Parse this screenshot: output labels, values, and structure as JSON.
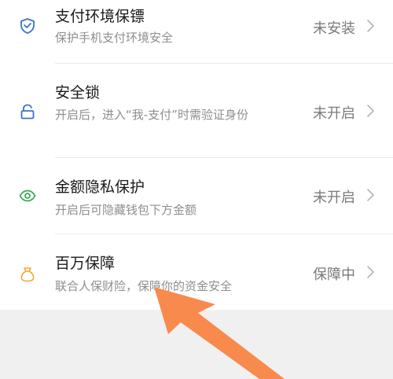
{
  "settings": {
    "items": [
      {
        "title": "支付环境保镖",
        "desc": "保护手机支付环境安全",
        "status": "未安装",
        "icon": "shield-check-icon",
        "color": "#3a72c9"
      },
      {
        "title": "安全锁",
        "desc": "开启后，进入“我-支付”时需验证身份",
        "status": "未开启",
        "icon": "lock-icon",
        "color": "#3a72c9"
      },
      {
        "title": "金额隐私保护",
        "desc": "开启后可隐藏钱包下方金额",
        "status": "未开启",
        "icon": "eye-icon",
        "color": "#3ca85a"
      },
      {
        "title": "百万保障",
        "desc": "联合人保财险，保障你的资金安全",
        "status": "保障中",
        "icon": "money-bag-icon",
        "color": "#f0a83a"
      }
    ]
  },
  "colors": {
    "annotation_arrow": "#f98a4e",
    "background": "#f0f0f0"
  }
}
